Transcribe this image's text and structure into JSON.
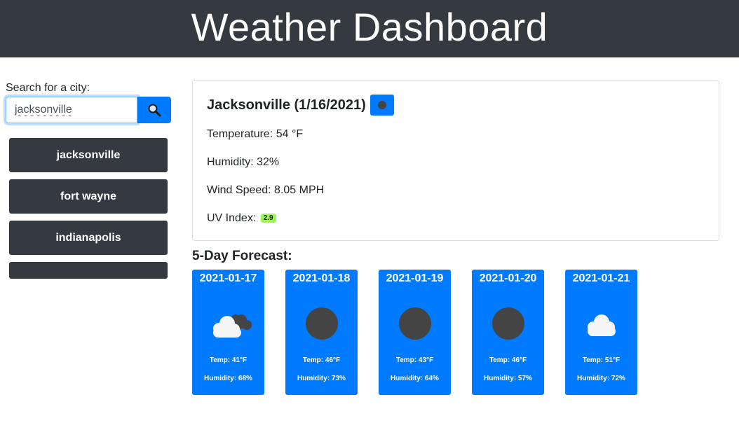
{
  "header": {
    "title": "Weather Dashboard"
  },
  "search": {
    "label": "Search for a city:",
    "value": "jacksonville",
    "button_icon": "search-icon"
  },
  "history": [
    {
      "label": "jacksonville"
    },
    {
      "label": "fort wayne"
    },
    {
      "label": "indianapolis"
    },
    {
      "label": ""
    }
  ],
  "current": {
    "title": "Jacksonville (1/16/2021)",
    "icon": "weather-icon",
    "temperature": "Temperature: 54 °F",
    "humidity": "Humidity: 32%",
    "wind": "Wind Speed: 8.05 MPH",
    "uv_label": "UV Index:",
    "uv_value": "2.9",
    "uv_color": "#9cf55a"
  },
  "forecast": {
    "title": "5-Day Forecast:",
    "days": [
      {
        "date": "2021-01-17",
        "icon": "cloudy-icon",
        "temp": "Temp: 41°F",
        "humidity": "Humidity: 68%"
      },
      {
        "date": "2021-01-18",
        "icon": "clear-icon",
        "temp": "Temp: 46°F",
        "humidity": "Humidity: 73%"
      },
      {
        "date": "2021-01-19",
        "icon": "clear-icon",
        "temp": "Temp: 43°F",
        "humidity": "Humidity: 64%"
      },
      {
        "date": "2021-01-20",
        "icon": "clear-icon",
        "temp": "Temp: 46°F",
        "humidity": "Humidity: 57%"
      },
      {
        "date": "2021-01-21",
        "icon": "cloud-icon",
        "temp": "Temp: 51°F",
        "humidity": "Humidity: 72%"
      }
    ]
  },
  "colors": {
    "header_bg": "#343a40",
    "accent": "#007bff",
    "history_bg": "#343a40"
  }
}
